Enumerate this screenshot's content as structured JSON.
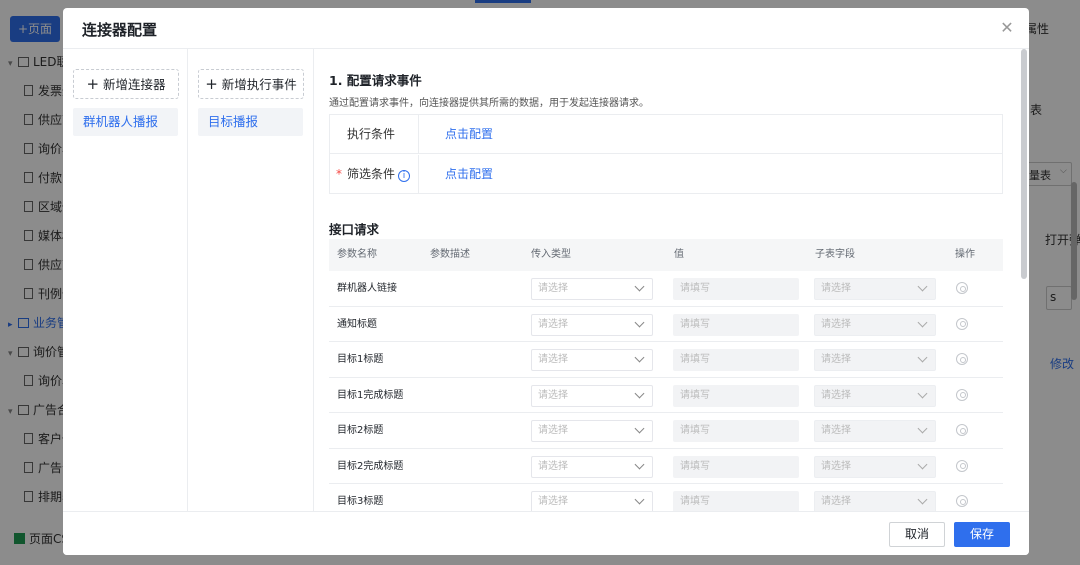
{
  "background": {
    "add_page_label": "+页面",
    "tree": [
      {
        "kind": "folder",
        "label": "LED联",
        "expanded": true
      },
      {
        "kind": "doc",
        "label": "发票登"
      },
      {
        "kind": "doc",
        "label": "供应商"
      },
      {
        "kind": "doc",
        "label": "询价单"
      },
      {
        "kind": "doc",
        "label": "付款申"
      },
      {
        "kind": "doc",
        "label": "区域信"
      },
      {
        "kind": "doc",
        "label": "媒体档"
      },
      {
        "kind": "doc",
        "label": "供应商"
      },
      {
        "kind": "doc",
        "label": "刊例价"
      },
      {
        "kind": "folder-collapsed",
        "label": "业务管",
        "highlight": true
      },
      {
        "kind": "folder",
        "label": "询价管",
        "expanded": true
      },
      {
        "kind": "doc",
        "label": "询价单"
      },
      {
        "kind": "folder",
        "label": "广告合",
        "expanded": true
      },
      {
        "kind": "doc",
        "label": "客户信"
      },
      {
        "kind": "doc",
        "label": "广告合"
      },
      {
        "kind": "doc",
        "label": "排期表"
      }
    ],
    "page_csv_label": "页面CS",
    "right_panel": {
      "attr_title": "属性",
      "text_biao": "表",
      "dropdown_label": "量表",
      "open_popup_label": "打开弹",
      "s_label": "s",
      "modify_label": "修改"
    }
  },
  "modal": {
    "title": "连接器配置",
    "close_icon": "close-icon",
    "add_connector_label": "新增连接器",
    "connectors": [
      {
        "label": "群机器人播报",
        "selected": true
      }
    ],
    "add_event_label": "新增执行事件",
    "events": [
      {
        "label": "目标播报",
        "selected": true
      }
    ],
    "section1": {
      "title": "1. 配置请求事件",
      "description": "通过配置请求事件，向连接器提供其所需的数据，用于发起连接器请求。",
      "rows": [
        {
          "label": "执行条件",
          "required": false,
          "info": false,
          "link": "点击配置"
        },
        {
          "label": "筛选条件",
          "required": true,
          "info": true,
          "link": "点击配置"
        }
      ]
    },
    "section2": {
      "title": "接口请求",
      "columns": [
        "参数名称",
        "参数描述",
        "传入类型",
        "值",
        "子表字段",
        "操作"
      ],
      "rows": [
        {
          "name": "群机器人链接",
          "type_placeholder": "请选择",
          "value_placeholder": "请填写",
          "subfield_placeholder": "请选择"
        },
        {
          "name": "通知标题",
          "type_placeholder": "请选择",
          "value_placeholder": "请填写",
          "subfield_placeholder": "请选择"
        },
        {
          "name": "目标1标题",
          "type_placeholder": "请选择",
          "value_placeholder": "请填写",
          "subfield_placeholder": "请选择"
        },
        {
          "name": "目标1完成标题",
          "type_placeholder": "请选择",
          "value_placeholder": "请填写",
          "subfield_placeholder": "请选择"
        },
        {
          "name": "目标2标题",
          "type_placeholder": "请选择",
          "value_placeholder": "请填写",
          "subfield_placeholder": "请选择"
        },
        {
          "name": "目标2完成标题",
          "type_placeholder": "请选择",
          "value_placeholder": "请填写",
          "subfield_placeholder": "请选择"
        },
        {
          "name": "目标3标题",
          "type_placeholder": "请选择",
          "value_placeholder": "请填写",
          "subfield_placeholder": "请选择"
        }
      ]
    },
    "footer": {
      "cancel_label": "取消",
      "save_label": "保存"
    }
  },
  "colors": {
    "accent": "#2f6fed",
    "required": "#f54a45",
    "overlay": "rgba(0,0,0,0.45)"
  }
}
